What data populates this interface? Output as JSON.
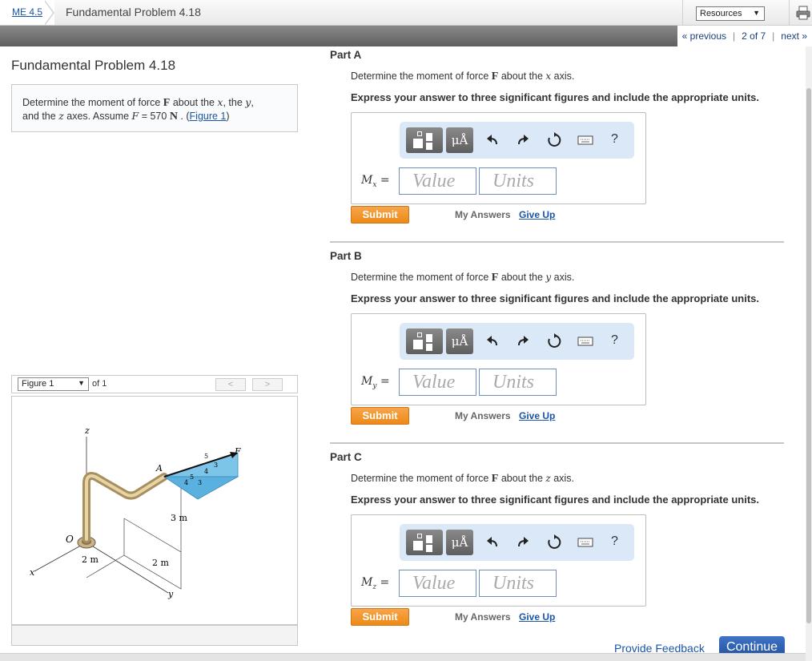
{
  "breadcrumb": {
    "course": "ME 4.5",
    "problem": "Fundamental Problem 4.18"
  },
  "resources": {
    "label": "Resources",
    "arrow": "▼"
  },
  "nav": {
    "previous": "« previous",
    "position": "2 of 7",
    "next": "next »"
  },
  "problem": {
    "title": "Fundamental Problem 4.18",
    "text_1": "Determine the moment of force ",
    "F": "F",
    "text_2": " about the ",
    "x": "x",
    "text_3": ", the ",
    "y": "y",
    "text_4": ",",
    "text_5": "and the ",
    "z": "z",
    "text_6": " axes. Assume ",
    "assume_eq": "F",
    "assume_val": " = 570 ",
    "assume_unit": "N",
    "text_7": " . (",
    "figure_link": "Figure 1",
    "text_8": ")"
  },
  "figure": {
    "select_label": "Figure 1",
    "of_label": "of 1",
    "prev": "<",
    "next": ">",
    "labels": {
      "z": "z",
      "F": "F",
      "A": "A",
      "O": "O",
      "x": "x",
      "y": "y",
      "d1": "3 m",
      "d2": "2 m",
      "d3": "2 m",
      "n5a": "5",
      "n3a": "3",
      "n4a": "4",
      "n5b": "5",
      "n4b": "4",
      "n3b": "3"
    }
  },
  "parts": [
    {
      "title": "Part A",
      "q1": "Determine the moment of force ",
      "F": "F",
      "q2": " about the ",
      "axis": "x",
      "q3": " axis.",
      "instr": "Express your answer to three significant figures and include the appropriate units.",
      "var": "M",
      "sub": "x",
      "eq": " =",
      "value_ph": "Value",
      "units_ph": "Units",
      "submit": "Submit",
      "myanswers": "My Answers",
      "giveup": "Give Up"
    },
    {
      "title": "Part B",
      "q1": "Determine the moment of force ",
      "F": "F",
      "q2": " about the ",
      "axis": "y",
      "q3": " axis.",
      "instr": "Express your answer to three significant figures and include the appropriate units.",
      "var": "M",
      "sub": "y",
      "eq": " =",
      "value_ph": "Value",
      "units_ph": "Units",
      "submit": "Submit",
      "myanswers": "My Answers",
      "giveup": "Give Up"
    },
    {
      "title": "Part C",
      "q1": "Determine the moment of force ",
      "F": "F",
      "q2": " about the ",
      "axis": "z",
      "q3": " axis.",
      "instr": "Express your answer to three significant figures and include the appropriate units.",
      "var": "M",
      "sub": "z",
      "eq": " =",
      "value_ph": "Value",
      "units_ph": "Units",
      "submit": "Submit",
      "myanswers": "My Answers",
      "giveup": "Give Up"
    }
  ],
  "toolbar": {
    "mu_label": "μÅ",
    "help_label": "?"
  },
  "footer": {
    "feedback": "Provide Feedback",
    "continue": "Continue"
  },
  "colors": {
    "accent_blue": "#21519e",
    "submit_orange": "#ec8a17",
    "toolbar_bg": "#dbe8f7"
  }
}
